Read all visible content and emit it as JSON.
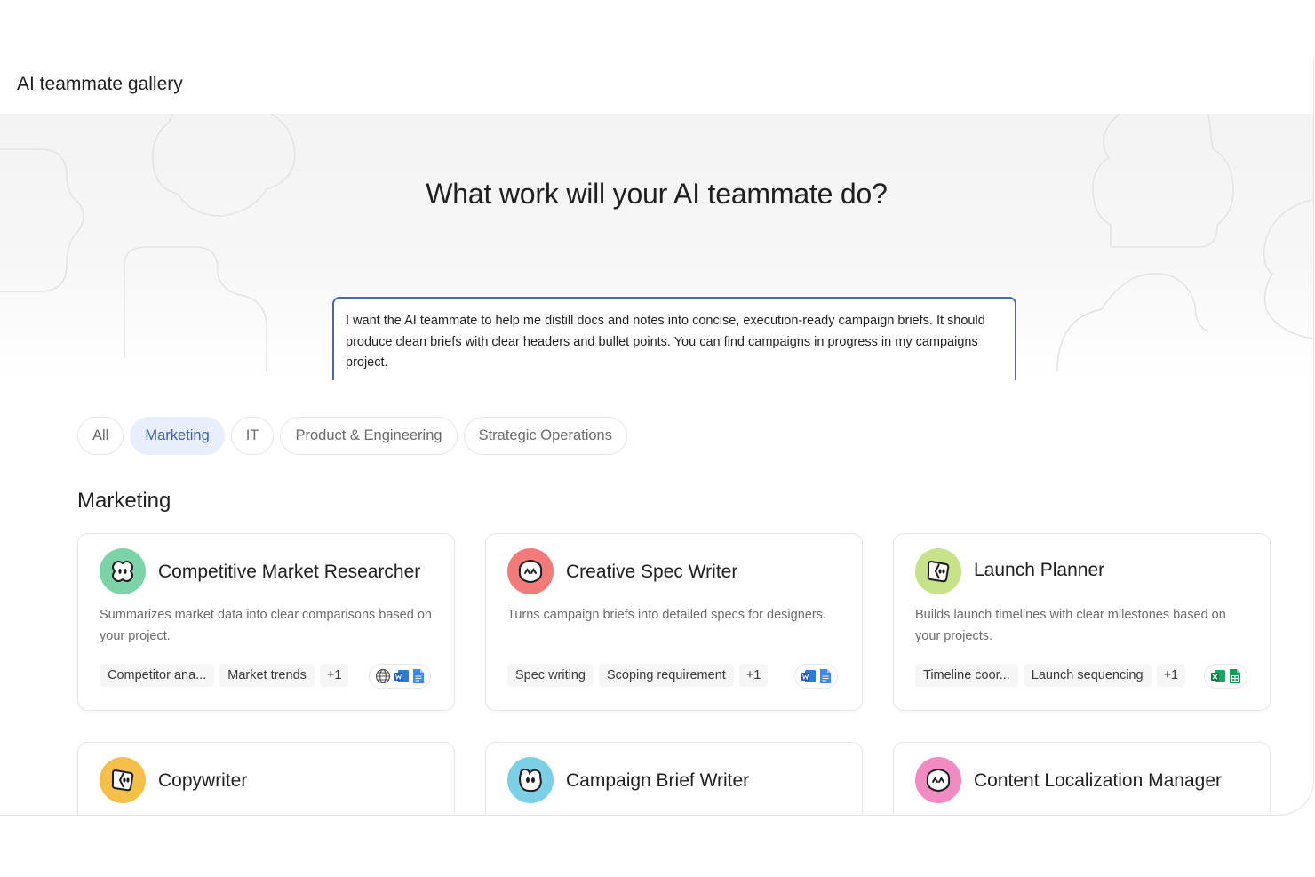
{
  "header": {
    "title": "AI teammate gallery"
  },
  "hero": {
    "heading": "What work will your AI teammate do?",
    "prompt_value": "I want the AI teammate to help me distill docs and notes into concise, execution-ready campaign briefs. It should produce clean briefs with clear headers and bullet points. You can find campaigns in progress in my campaigns project.",
    "mention_symbol": "@",
    "send_icon": "arrow-up-icon"
  },
  "filters": [
    {
      "label": "All",
      "active": false
    },
    {
      "label": "Marketing",
      "active": true
    },
    {
      "label": "IT",
      "active": false
    },
    {
      "label": "Product & Engineering",
      "active": false
    },
    {
      "label": "Strategic Operations",
      "active": false
    }
  ],
  "section": {
    "title": "Marketing"
  },
  "cards": [
    {
      "name": "Competitive Market Researcher",
      "avatar_color": "#7dd3a8",
      "description": "Summarizes market data into clear comparisons based on your project.",
      "tags": [
        "Competitor ana...",
        "Market trends",
        "+1"
      ],
      "apps": [
        "globe-icon",
        "word-icon",
        "google-docs-icon"
      ]
    },
    {
      "name": "Creative Spec Writer",
      "avatar_color": "#f27a7a",
      "description": "Turns campaign briefs into detailed specs for designers.",
      "tags": [
        "Spec writing",
        "Scoping requirement",
        "+1"
      ],
      "apps": [
        "word-icon",
        "google-docs-icon"
      ]
    },
    {
      "name": "Launch Planner",
      "avatar_color": "#c7e38a",
      "description": "Builds launch timelines with clear milestones based on your projects.",
      "tags": [
        "Timeline coor...",
        "Launch sequencing",
        "+1"
      ],
      "apps": [
        "excel-icon",
        "google-sheets-icon"
      ]
    },
    {
      "name": "Copywriter",
      "avatar_color": "#f5c04a"
    },
    {
      "name": "Campaign Brief Writer",
      "avatar_color": "#7cd0e6"
    },
    {
      "name": "Content Localization Manager",
      "avatar_color": "#f28bc1"
    }
  ]
}
